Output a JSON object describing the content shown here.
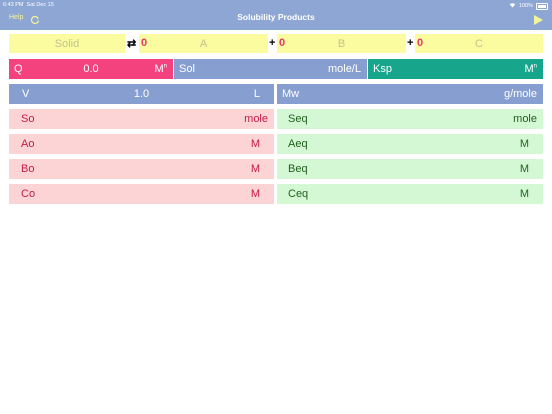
{
  "status_bar": {
    "time": "6:43 PM",
    "date": "Sat Dec 15",
    "battery": "100%"
  },
  "nav": {
    "help": "Help",
    "title": "Solubility Products"
  },
  "equation": {
    "solid": "Solid",
    "arrow": "⇄",
    "plus": "+",
    "coef_a": "0",
    "a": "A",
    "coef_b": "0",
    "b": "B",
    "coef_c": "0",
    "c": "C"
  },
  "row2": {
    "q_label": "Q",
    "q_value": "0.0",
    "q_unit": "M",
    "sol_label": "Sol",
    "sol_unit": "mole/L",
    "ksp_label": "Ksp",
    "ksp_unit": "M"
  },
  "row3": {
    "v_label": "V",
    "v_value": "1.0",
    "v_unit": "L",
    "mw_label": "Mw",
    "mw_unit": "g/mole"
  },
  "left_rows": [
    {
      "label": "So",
      "unit": "mole"
    },
    {
      "label": "Ao",
      "unit": "M"
    },
    {
      "label": "Bo",
      "unit": "M"
    },
    {
      "label": "Co",
      "unit": "M"
    }
  ],
  "right_rows": [
    {
      "label": "Seq",
      "unit": "mole"
    },
    {
      "label": "Aeq",
      "unit": "M"
    },
    {
      "label": "Beq",
      "unit": "M"
    },
    {
      "label": "Ceq",
      "unit": "M"
    }
  ],
  "colors": {
    "header": "#8ea6d4",
    "accent": "#f4427f",
    "teal": "#17a58b"
  }
}
